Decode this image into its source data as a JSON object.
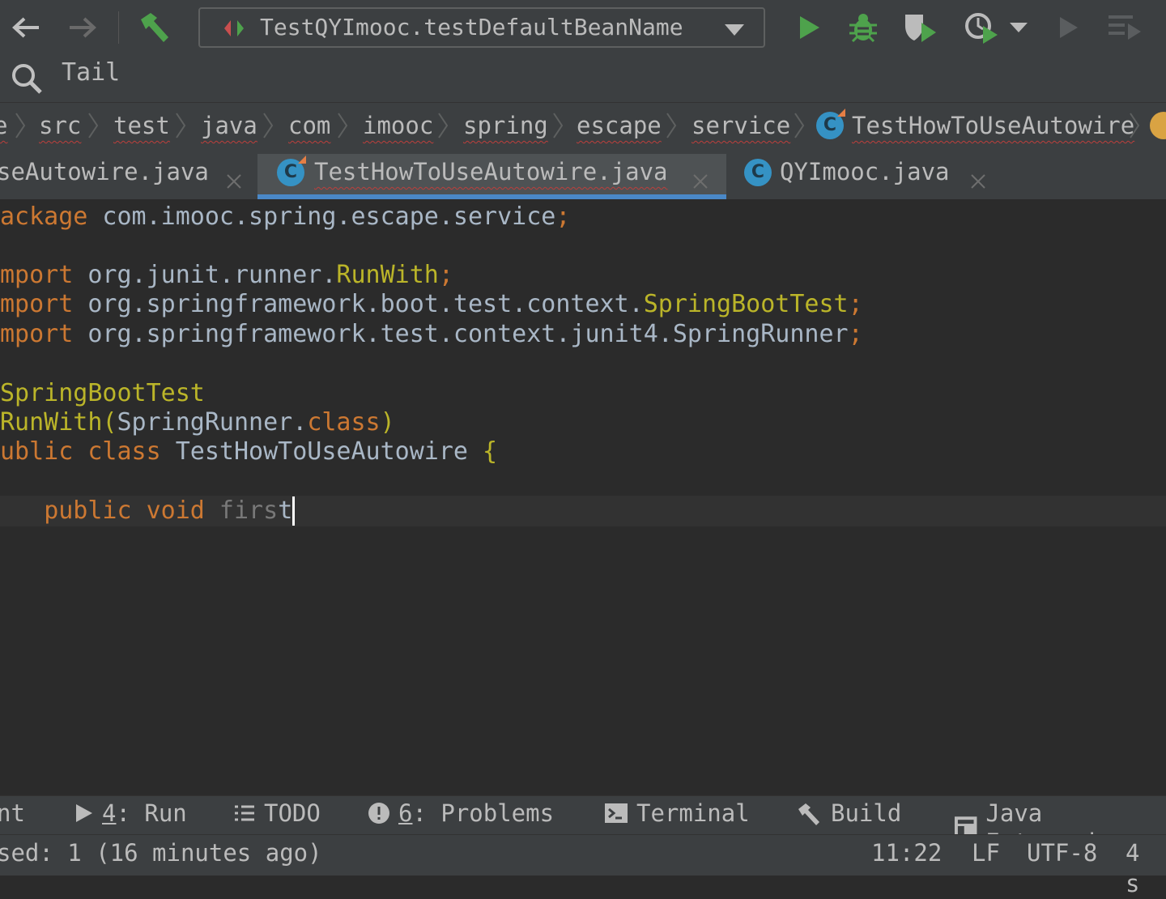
{
  "toolbar": {
    "run_config": "TestQYImooc.testDefaultBeanName",
    "colors": {
      "run": "#4ea24c",
      "debug": "#4ea24c",
      "build": "#4ea24c"
    }
  },
  "search": {
    "text": "Tail"
  },
  "breadcrumbs": {
    "lead": "e",
    "items": [
      "src",
      "test",
      "java",
      "com",
      "imooc",
      "spring",
      "escape",
      "service",
      "TestHowToUseAutowire"
    ]
  },
  "tabs": [
    {
      "label": "seAutowire.java"
    },
    {
      "label": "TestHowToUseAutowire.java"
    },
    {
      "label": "QYImooc.java"
    }
  ],
  "code": {
    "line1": {
      "kw": "ackage",
      "rest": " com.imooc.spring.escape.service",
      "semi": ";"
    },
    "line2": {
      "kw": "mport",
      "pkg": " org.junit.runner.",
      "cls": "RunWith",
      "semi": ";"
    },
    "line3": {
      "kw": "mport",
      "pkg": " org.springframework.boot.test.context.",
      "cls": "SpringBootTest",
      "semi": ";"
    },
    "line4": {
      "kw": "mport",
      "pkg": " org.springframework.test.context.junit4.",
      "cls": "SpringRunner",
      "semi": ";"
    },
    "line5": {
      "an": "SpringBootTest"
    },
    "line6": {
      "an": "RunWith",
      "open": "(",
      "arg": "SpringRunner.",
      "kw": "class",
      "close": ")"
    },
    "line7": {
      "kw1": "ublic",
      "kw2": " class",
      "name": " TestHowToUseAutowire",
      "brace": " {"
    },
    "line8": {
      "indent": "   ",
      "kw1": "public",
      "kw2": " void",
      "typed": " firs",
      "t": "t"
    }
  },
  "toolwindows": {
    "lead": "nt",
    "run": {
      "num": "4",
      "label": ": Run"
    },
    "todo": "TODO",
    "problems": {
      "num": "6",
      "label": ": Problems"
    },
    "terminal": "Terminal",
    "build": "Build",
    "java_ee": "Java Enterpri"
  },
  "status": {
    "message": "sed: 1 (16 minutes ago)",
    "position": "11:22",
    "line_sep": "LF",
    "encoding": "UTF-8",
    "indent": "4 s"
  }
}
